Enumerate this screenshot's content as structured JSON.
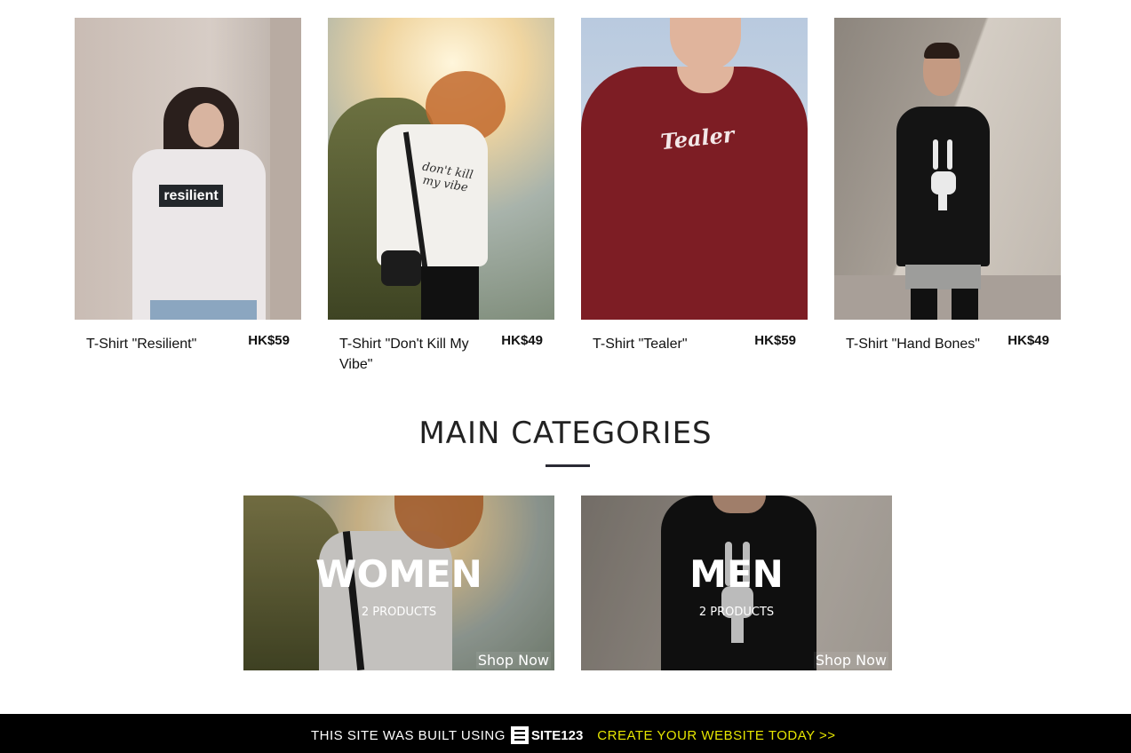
{
  "products": [
    {
      "name": "T-Shirt \"Resilient\"",
      "price": "HK$59",
      "shirt_print": "resilient"
    },
    {
      "name": "T-Shirt \"Don't Kill My Vibe\"",
      "price": "HK$49",
      "shirt_print": "don't kill my vibe"
    },
    {
      "name": "T-Shirt \"Tealer\"",
      "price": "HK$59",
      "shirt_print": "Tealer"
    },
    {
      "name": "T-Shirt \"Hand Bones\"",
      "price": "HK$49"
    }
  ],
  "main_categories": {
    "title": "MAIN CATEGORIES",
    "items": [
      {
        "title": "WOMEN",
        "count": "2 PRODUCTS",
        "cta": "Shop Now"
      },
      {
        "title": "MEN",
        "count": "2 PRODUCTS",
        "cta": "Shop Now"
      }
    ]
  },
  "footer": {
    "built_text": "THIS SITE WAS BUILT USING",
    "logo_text": "SITE123",
    "cta": "CREATE YOUR WEBSITE TODAY >>",
    "cta_color": "#e6e600"
  }
}
